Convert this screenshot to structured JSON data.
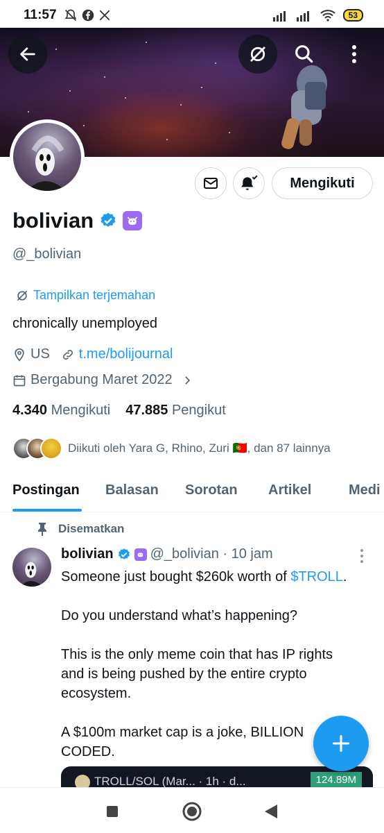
{
  "status_bar": {
    "time": "11:57",
    "battery": "53"
  },
  "profile": {
    "name": "bolivian",
    "handle": "@_bolivian",
    "translate_label": "Tampilkan terjemahan",
    "bio": "chronically unemployed",
    "location": "US",
    "link": "t.me/bolijournal",
    "joined": "Bergabung Maret 2022",
    "following_count": "4.340",
    "following_label": "Mengikuti",
    "followers_count": "47.885",
    "followers_label": "Pengikut",
    "followed_by": "Diikuti oleh Yara G, Rhino, Zuri 🇵🇹, dan 87 lainnya",
    "follow_button": "Mengikuti"
  },
  "tabs": [
    "Postingan",
    "Balasan",
    "Sorotan",
    "Artikel",
    "Medi"
  ],
  "pinned_post": {
    "pinned_label": "Disematkan",
    "author_name": "bolivian",
    "author_handle_time": "@_bolivian · 10 jam",
    "line1_text": "Someone just bought $260k worth of ",
    "line1_tag": "$TROLL",
    "line1_end": ".",
    "para2": "Do you understand what’s happening?",
    "para3": "This is the only meme coin that has IP rights and is being pushed by the entire crypto ecosystem.",
    "para4": "A $100m market cap is a joke, BILLION CODED.",
    "media_text": "TROLL/SOL (Mar... · 1h · d...",
    "media_price": "124.89M"
  },
  "colors": {
    "accent": "#1d9bf0",
    "secondary_text": "#536471",
    "badge_purple": "#9b6cf0"
  }
}
